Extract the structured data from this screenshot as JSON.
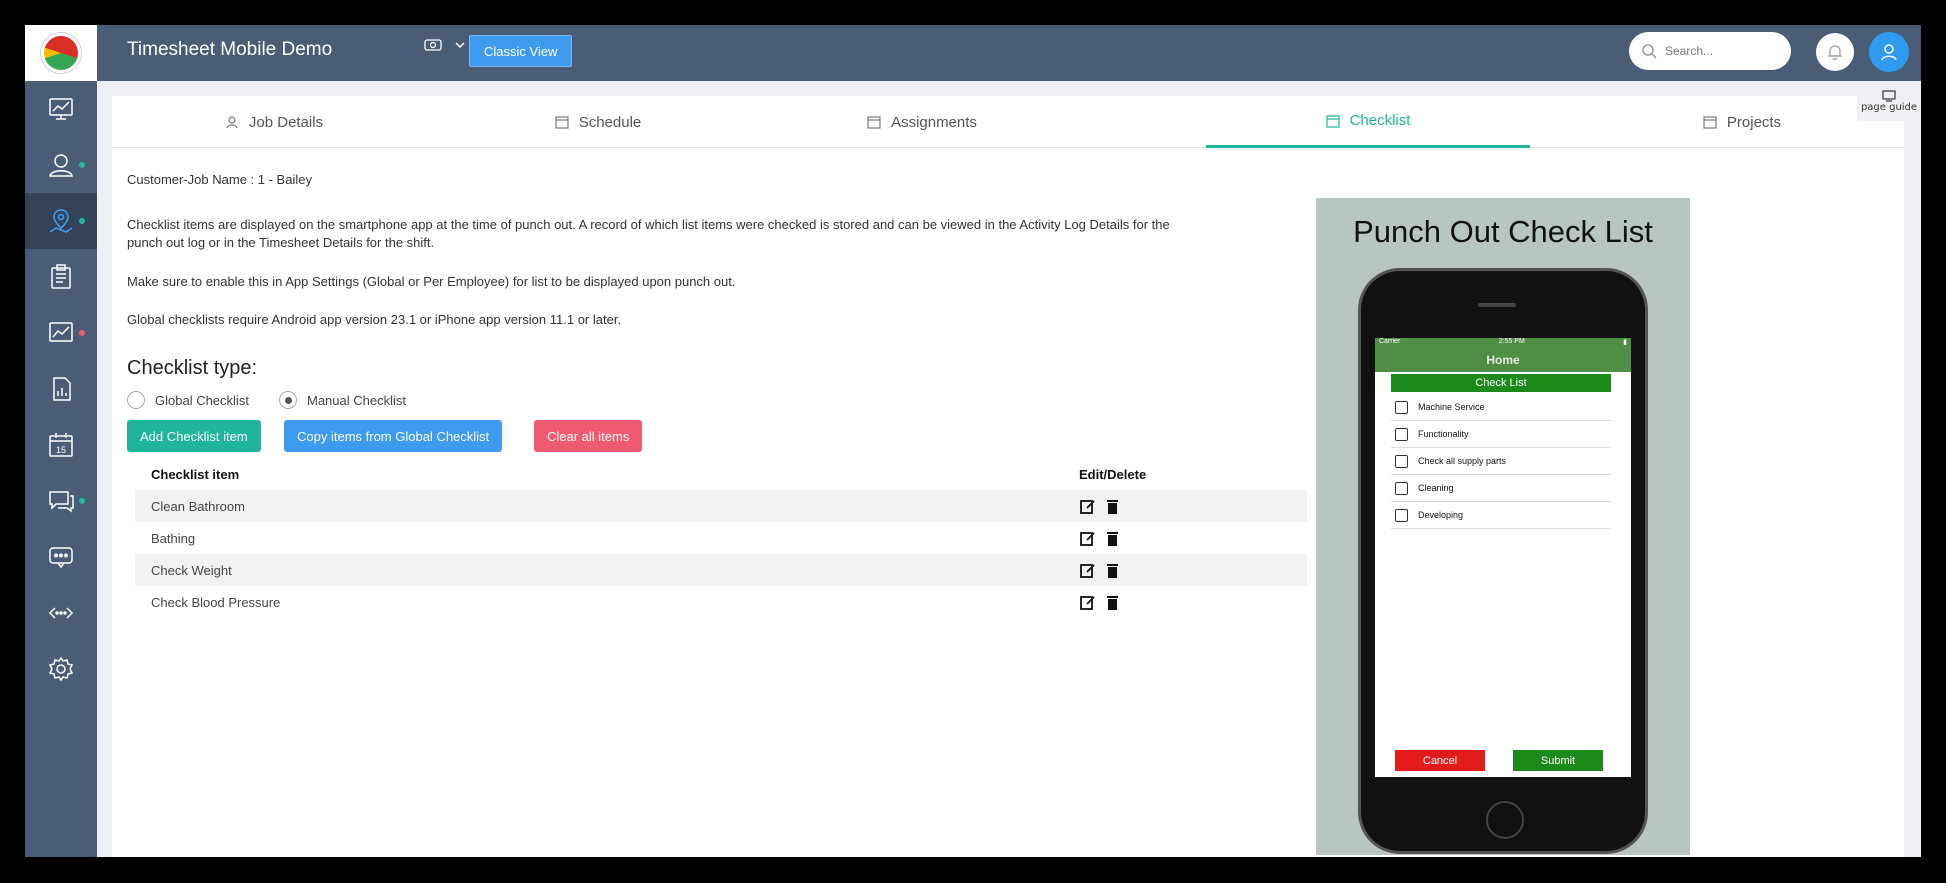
{
  "header": {
    "app_title": "Timesheet Mobile Demo",
    "classic_view_label": "Classic View",
    "search_placeholder": "Search..."
  },
  "page_guide": {
    "label": "page guide"
  },
  "tabs": [
    {
      "label": "Job Details",
      "active": false
    },
    {
      "label": "Schedule",
      "active": false
    },
    {
      "label": "Assignments",
      "active": false
    },
    {
      "label": "Checklist",
      "active": true
    },
    {
      "label": "Projects",
      "active": false
    }
  ],
  "content": {
    "customer_job": "Customer-Job Name : 1 - Bailey",
    "para1_line1": "Checklist items are displayed on the smartphone app at the time of punch out. A record of which list items were checked is stored and can be viewed in the Activity Log Details for the",
    "para1_line2": "punch out log or in the Timesheet Details for the shift.",
    "para2": "Make sure to enable this in App Settings (Global or Per Employee) for list to be displayed upon punch out.",
    "para3": "Global checklists require Android app version 23.1 or iPhone app version 11.1 or later.",
    "checklist_type_heading": "Checklist type:",
    "radio_global": "Global Checklist",
    "radio_manual": "Manual Checklist",
    "selected_type": "Manual Checklist"
  },
  "buttons": {
    "add": "Add Checklist item",
    "copy": "Copy items from Global Checklist",
    "clear": "Clear all items"
  },
  "table": {
    "col_item": "Checklist item",
    "col_actions": "Edit/Delete",
    "rows": [
      "Clean Bathroom",
      "Bathing",
      "Check Weight",
      "Check Blood Pressure"
    ]
  },
  "phone": {
    "title": "Punch Out Check List",
    "carrier": "Carrier",
    "time": "2:55 PM",
    "home": "Home",
    "list_title": "Check List",
    "items": [
      "Machine Service",
      "Functionality",
      "Check all supply parts",
      "Cleaning",
      "Developing"
    ],
    "cancel": "Cancel",
    "submit": "Submit"
  },
  "colors": {
    "sidebar": "#4a5c76",
    "accent_teal": "#1fb59a",
    "classic_blue": "#3f9bf0",
    "clear_red": "#ef5a6f"
  }
}
